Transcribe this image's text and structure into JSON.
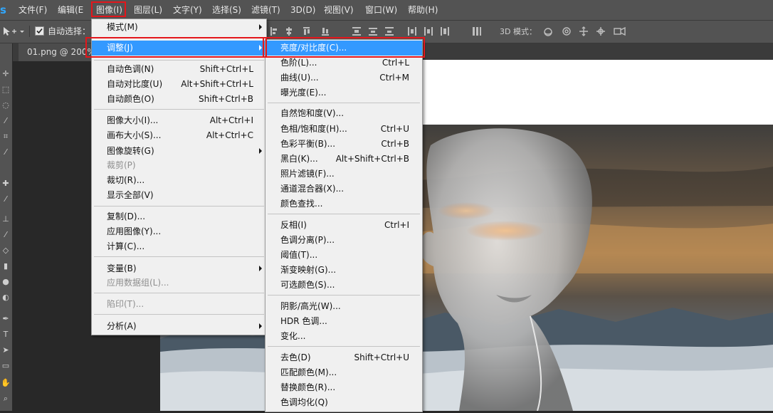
{
  "app": {
    "logo": "s"
  },
  "menubar": {
    "items": [
      "文件(F)",
      "编辑(E",
      "图像(I)",
      "图层(L)",
      "文字(Y)",
      "选择(S)",
      "滤镜(T)",
      "3D(D)",
      "视图(V)",
      "窗口(W)",
      "帮助(H)"
    ],
    "active": "图像(I)"
  },
  "options": {
    "auto_select_label": "自动选择：",
    "auto_select_checked": true,
    "mode_3d_label": "3D 模式："
  },
  "document_tab": {
    "label": "01.png @ 200% "
  },
  "image_menu": {
    "items": [
      {
        "label": "模式(M)",
        "shortcut": "",
        "submenu": true
      },
      {
        "label": "调整(J)",
        "shortcut": "",
        "submenu": true,
        "highlighted": true
      },
      {
        "label": "自动色调(N)",
        "shortcut": "Shift+Ctrl+L"
      },
      {
        "label": "自动对比度(U)",
        "shortcut": "Alt+Shift+Ctrl+L"
      },
      {
        "label": "自动颜色(O)",
        "shortcut": "Shift+Ctrl+B"
      },
      {
        "label": "图像大小(I)...",
        "shortcut": "Alt+Ctrl+I"
      },
      {
        "label": "画布大小(S)...",
        "shortcut": "Alt+Ctrl+C"
      },
      {
        "label": "图像旋转(G)",
        "shortcut": "",
        "submenu": true
      },
      {
        "label": "裁剪(P)",
        "shortcut": "",
        "disabled": true
      },
      {
        "label": "裁切(R)...",
        "shortcut": ""
      },
      {
        "label": "显示全部(V)",
        "shortcut": ""
      },
      {
        "label": "复制(D)...",
        "shortcut": ""
      },
      {
        "label": "应用图像(Y)...",
        "shortcut": ""
      },
      {
        "label": "计算(C)...",
        "shortcut": ""
      },
      {
        "label": "变量(B)",
        "shortcut": "",
        "submenu": true
      },
      {
        "label": "应用数据组(L)...",
        "shortcut": "",
        "disabled": true
      },
      {
        "label": "陷印(T)...",
        "shortcut": "",
        "disabled": true
      },
      {
        "label": "分析(A)",
        "shortcut": "",
        "submenu": true
      }
    ]
  },
  "adjust_menu": {
    "items": [
      {
        "label": "亮度/对比度(C)...",
        "shortcut": "",
        "highlighted": true
      },
      {
        "label": "色阶(L)...",
        "shortcut": "Ctrl+L"
      },
      {
        "label": "曲线(U)...",
        "shortcut": "Ctrl+M"
      },
      {
        "label": "曝光度(E)...",
        "shortcut": ""
      },
      {
        "label": "自然饱和度(V)...",
        "shortcut": ""
      },
      {
        "label": "色相/饱和度(H)...",
        "shortcut": "Ctrl+U"
      },
      {
        "label": "色彩平衡(B)...",
        "shortcut": "Ctrl+B"
      },
      {
        "label": "黑白(K)...",
        "shortcut": "Alt+Shift+Ctrl+B"
      },
      {
        "label": "照片滤镜(F)...",
        "shortcut": ""
      },
      {
        "label": "通道混合器(X)...",
        "shortcut": ""
      },
      {
        "label": "颜色查找...",
        "shortcut": ""
      },
      {
        "label": "反相(I)",
        "shortcut": "Ctrl+I"
      },
      {
        "label": "色调分离(P)...",
        "shortcut": ""
      },
      {
        "label": "阈值(T)...",
        "shortcut": ""
      },
      {
        "label": "渐变映射(G)...",
        "shortcut": ""
      },
      {
        "label": "可选颜色(S)...",
        "shortcut": ""
      },
      {
        "label": "阴影/高光(W)...",
        "shortcut": ""
      },
      {
        "label": "HDR 色调...",
        "shortcut": ""
      },
      {
        "label": "变化...",
        "shortcut": ""
      },
      {
        "label": "去色(D)",
        "shortcut": "Shift+Ctrl+U"
      },
      {
        "label": "匹配颜色(M)...",
        "shortcut": ""
      },
      {
        "label": "替换颜色(R)...",
        "shortcut": ""
      },
      {
        "label": "色调均化(Q)",
        "shortcut": ""
      }
    ]
  },
  "colors": {
    "highlight": "#3399ff",
    "annotation": "#e4161b",
    "menu_bg": "#f0f0f0",
    "chrome": "#535353"
  }
}
